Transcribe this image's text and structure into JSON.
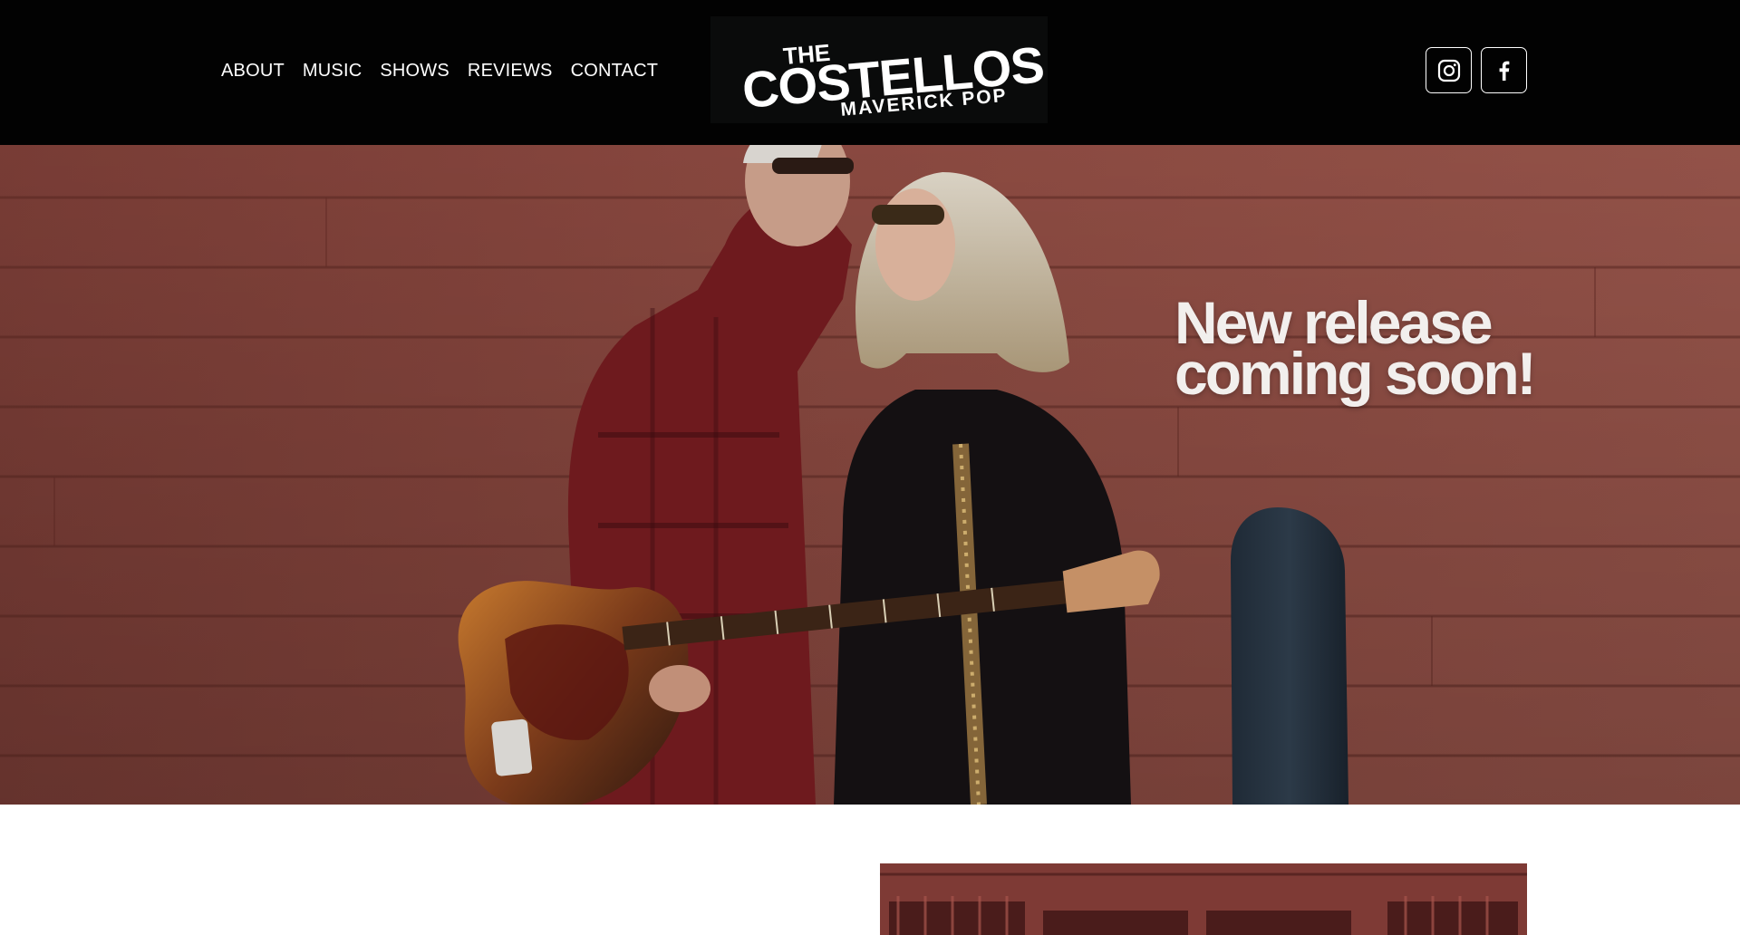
{
  "nav": {
    "items": [
      {
        "label": "ABOUT"
      },
      {
        "label": "MUSIC"
      },
      {
        "label": "SHOWS"
      },
      {
        "label": "REVIEWS"
      },
      {
        "label": "CONTACT"
      }
    ]
  },
  "logo": {
    "the": "THE",
    "name": "COSTELLOS",
    "tagline": "MAVERICK POP"
  },
  "social": {
    "instagram_icon": "instagram-icon",
    "facebook_icon": "facebook-icon"
  },
  "hero": {
    "headline_line1": "New release",
    "headline_line2": "coming soon!"
  },
  "colors": {
    "header_bg": "#020202",
    "wall": "#8e4b42",
    "text_light": "#f2efed"
  }
}
